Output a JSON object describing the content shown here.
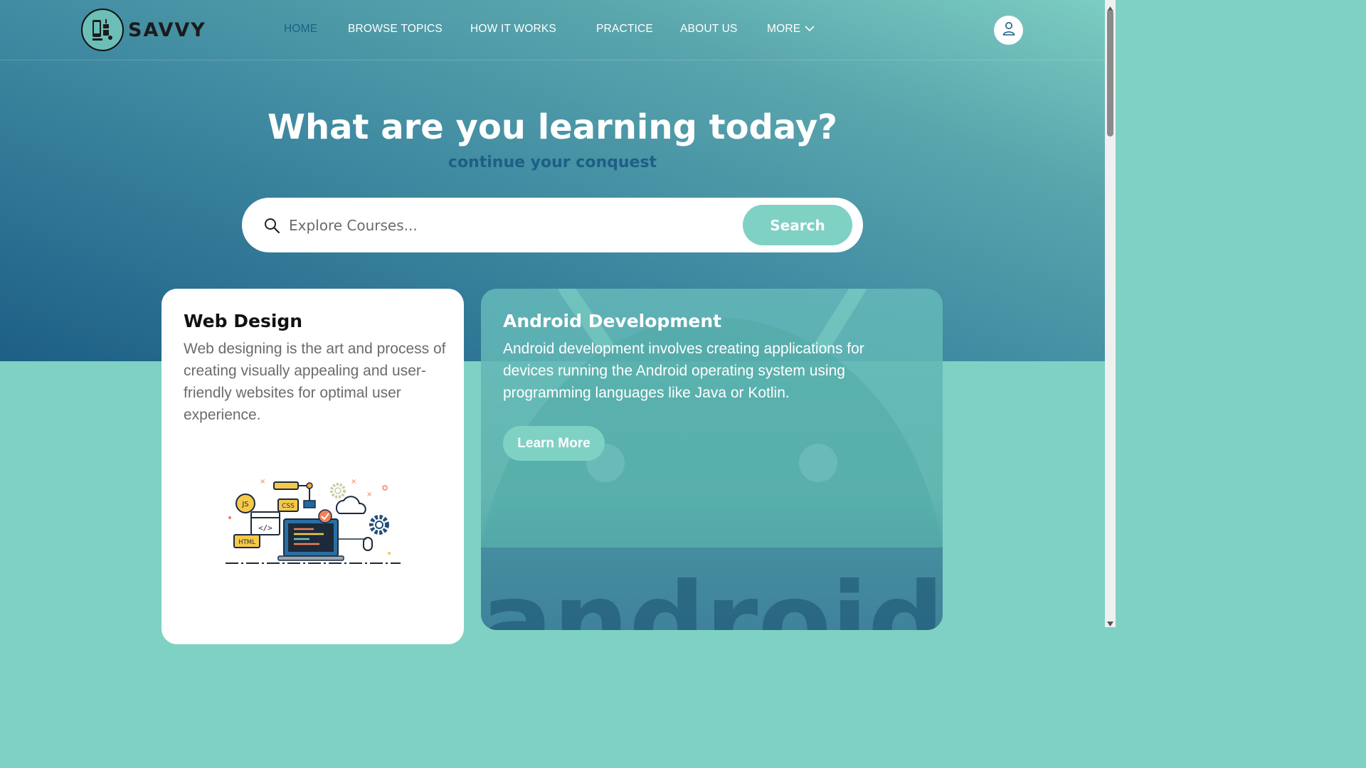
{
  "brand": {
    "name": "SAVVY"
  },
  "nav": {
    "items": [
      {
        "label": "HOME",
        "active": true
      },
      {
        "label": "BROWSE TOPICS",
        "active": false
      },
      {
        "label": "HOW IT WORKS",
        "active": false
      },
      {
        "label": "PRACTICE",
        "active": false
      },
      {
        "label": "ABOUT US",
        "active": false
      },
      {
        "label": "MORE",
        "active": false,
        "has_dropdown": true
      }
    ],
    "user_icon": "user-icon"
  },
  "hero": {
    "title": "What are you learning today?",
    "subtitle": "continue your conquest"
  },
  "search": {
    "placeholder": "Explore Courses...",
    "button_label": "Search",
    "icon": "search-icon"
  },
  "cards": [
    {
      "title": "Web Design",
      "description": "Web designing is the art and process of creating visually appealing and user-friendly websites for optimal user experience.",
      "illustration_labels": [
        "JS",
        "CSS",
        "HTML"
      ]
    },
    {
      "title": "Android Development",
      "description": "Android development involves creating applications for devices running the Android operating system using programming languages like Java or Kotlin.",
      "button_label": "Learn More",
      "background_word": "android"
    }
  ],
  "colors": {
    "accent": "#7fd1c4",
    "active_nav": "#1d5f86",
    "hero_dark": "#1d5f86",
    "hero_light": "#7ccdc2"
  }
}
